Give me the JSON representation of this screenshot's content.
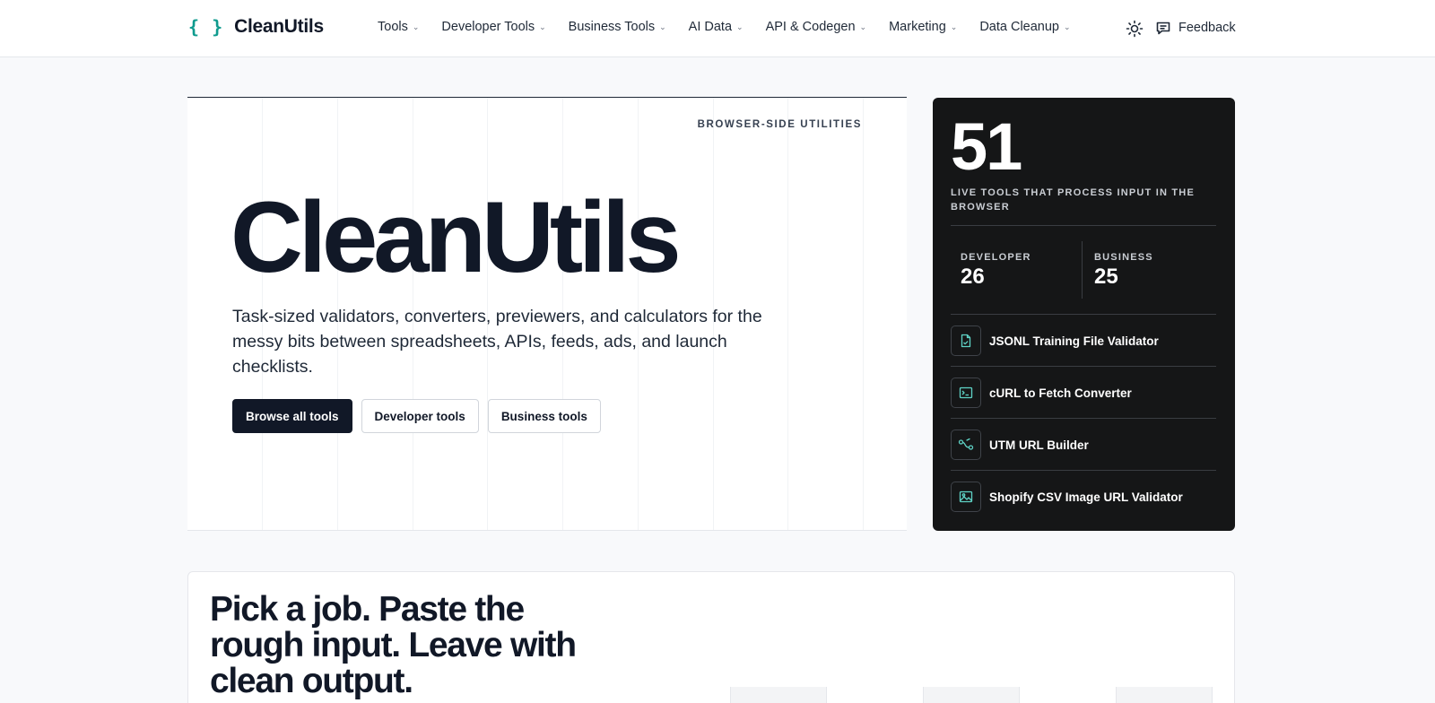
{
  "header": {
    "brand_icon": "{ }",
    "brand_name": "CleanUtils",
    "nav": [
      {
        "label": "Tools"
      },
      {
        "label": "Developer Tools"
      },
      {
        "label": "Business Tools"
      },
      {
        "label": "AI Data"
      },
      {
        "label": "API & Codegen"
      },
      {
        "label": "Marketing"
      },
      {
        "label": "Data Cleanup"
      }
    ],
    "chevron_glyph": "⌄",
    "theme_icon": "sun-icon",
    "feedback_label": "Feedback",
    "feedback_icon": "chat-icon"
  },
  "hero": {
    "eyebrow": "BROWSER-SIDE UTILITIES",
    "title": "CleanUtils",
    "description": "Task-sized validators, converters, previewers, and calculators for the messy bits between spreadsheets, APIs, feeds, ads, and launch checklists.",
    "actions": {
      "browse": "Browse all tools",
      "developer": "Developer tools",
      "business": "Business tools"
    }
  },
  "stats": {
    "total": "51",
    "caption": "LIVE TOOLS THAT PROCESS INPUT IN THE BROWSER",
    "developer_label": "DEVELOPER",
    "developer_count": "26",
    "business_label": "BUSINESS",
    "business_count": "25",
    "featured": [
      {
        "label": "JSONL Training File Validator",
        "icon": "file-check-icon"
      },
      {
        "label": "cURL to Fetch Converter",
        "icon": "terminal-icon"
      },
      {
        "label": "UTM URL Builder",
        "icon": "route-icon"
      },
      {
        "label": "Shopify CSV Image URL Validator",
        "icon": "image-icon"
      }
    ]
  },
  "jobs": {
    "title": "Pick a job. Paste the rough input. Leave with clean output."
  },
  "colors": {
    "accent": "#0f9b8e",
    "dark_panel": "#151617",
    "text": "#111827"
  }
}
